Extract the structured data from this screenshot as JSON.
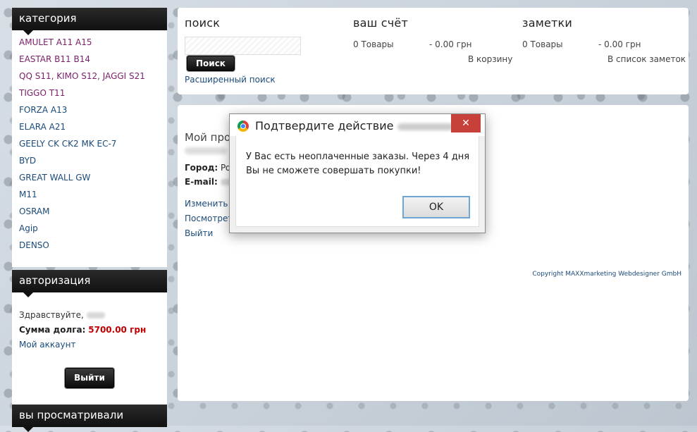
{
  "category": {
    "title": "категория",
    "items": [
      "AMULET A11 A15",
      "EASTAR B11 B14",
      "QQ S11, KIMO S12, JAGGI S21",
      "TIGGO T11",
      "FORZA A13",
      "ELARA A21",
      "GEELY CK CK2 MK EC-7",
      "BYD",
      "GREAT WALL GW",
      "M11",
      "OSRAM",
      "Agip",
      "DENSO"
    ]
  },
  "auth": {
    "title": "авторизация",
    "greeting": "Здравствуйте,",
    "debt_label": "Сумма долга:",
    "debt_value": "5700.00 грн",
    "account_link": "Мой аккаунт",
    "logout_button": "Выйти"
  },
  "viewed": {
    "title": "вы просматривали"
  },
  "search": {
    "title": "поиск",
    "button": "Поиск",
    "advanced": "Расширенный поиск"
  },
  "account": {
    "title": "ваш счёт",
    "goods": "0 Товары",
    "sum": "- 0.00 грн",
    "link": "В корзину"
  },
  "notes": {
    "title": "заметки",
    "goods": "0 Товары",
    "sum": "- 0.00 грн",
    "link": "В список заметок"
  },
  "profile": {
    "title": "Мой проф",
    "city_label": "Город:",
    "city_value": "Po",
    "email_label": "E-mail:",
    "links": [
      "Изменить м",
      "Посмотрет",
      "Выйти"
    ]
  },
  "copyright": "Copyright MAXXmarketing Webdesigner GmbH",
  "dialog": {
    "title": "Подтвердите действие",
    "message": "У Вас есть неоплаченные заказы. Через 4 дня Вы не сможете совершать покупки!",
    "ok": "OK",
    "close_glyph": "✕"
  }
}
